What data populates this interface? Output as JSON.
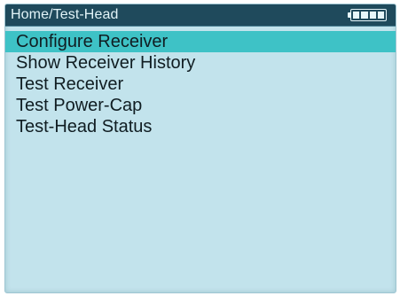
{
  "header": {
    "breadcrumb": "Home/Test-Head",
    "battery_icon": "battery-full-icon",
    "battery_level": 1.0,
    "battery_cells": 4
  },
  "menu": {
    "selected_index": 0,
    "items": [
      {
        "label": "Configure Receiver"
      },
      {
        "label": "Show Receiver History"
      },
      {
        "label": "Test Receiver"
      },
      {
        "label": "Test Power-Cap"
      },
      {
        "label": "Test-Head Status"
      }
    ]
  },
  "colors": {
    "screen_background": "#c2e3ec",
    "header_background": "#1f4a5c",
    "header_text": "#e2f4f8",
    "selection_highlight": "#3ec2c6",
    "menu_text": "#101d22"
  }
}
